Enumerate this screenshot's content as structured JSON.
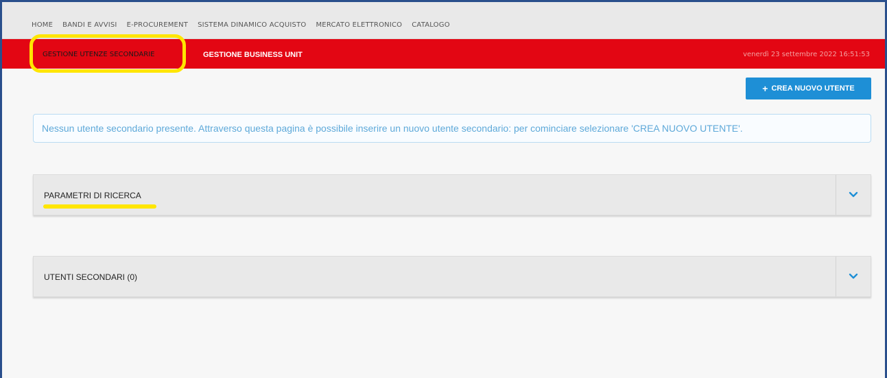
{
  "topnav": {
    "items": [
      {
        "label": "HOME"
      },
      {
        "label": "BANDI E AVVISI"
      },
      {
        "label": "E-PROCUREMENT"
      },
      {
        "label": "SISTEMA DINAMICO ACQUISTO"
      },
      {
        "label": "MERCATO ELETTRONICO"
      },
      {
        "label": "CATALOGO"
      }
    ]
  },
  "redbar": {
    "tab_secondary_users": "GESTIONE UTENZE SECONDARIE",
    "tab_business_unit": "GESTIONE BUSINESS UNIT",
    "datetime": "venerdì 23 settembre 2022 16:51:53"
  },
  "actions": {
    "create_user_label": "CREA NUOVO UTENTE"
  },
  "info": {
    "message": "Nessun utente secondario presente. Attraverso questa pagina è possibile inserire un nuovo utente secondario: per cominciare selezionare 'CREA NUOVO UTENTE'."
  },
  "panels": {
    "search_params": "PARAMETRI DI RICERCA",
    "secondary_users": "UTENTI SECONDARI (0)"
  },
  "colors": {
    "accent_red": "#e30613",
    "button_blue": "#1e8fd6",
    "highlight_yellow": "#ffe600",
    "info_text": "#5ea9d9"
  },
  "icons": {
    "plus": "plus-icon",
    "chevron": "chevron-down-icon"
  }
}
